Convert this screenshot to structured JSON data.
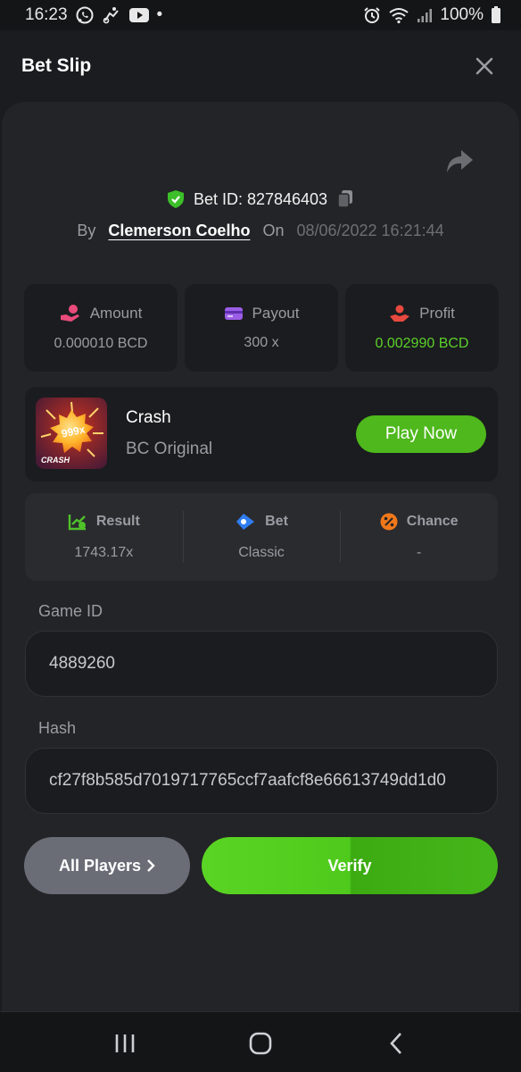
{
  "status_bar": {
    "time": "16:23",
    "battery": "100%",
    "dot": "•"
  },
  "header": {
    "title": "Bet Slip"
  },
  "bet": {
    "id_label": "Bet ID: 827846403",
    "by_label": "By",
    "user": "Clemerson Coelho",
    "on_label": "On",
    "date": "08/06/2022 16:21:44"
  },
  "stats": [
    {
      "label": "Amount",
      "value": "0.000010 BCD",
      "icon": "hand-coin-icon",
      "color": "#e94b7b"
    },
    {
      "label": "Payout",
      "value": "300 x",
      "icon": "wallet-card-icon",
      "color": "#9b5de5"
    },
    {
      "label": "Profit",
      "value": "0.002990 BCD",
      "icon": "hand-profit-icon",
      "color": "#e8493f"
    }
  ],
  "game": {
    "thumb_multiplier": "999x",
    "thumb_label": "CRASH",
    "name": "Crash",
    "subtitle": "BC Original",
    "play_label": "Play Now"
  },
  "details": [
    {
      "label": "Result",
      "value": "1743.17x",
      "icon": "chart-check-icon"
    },
    {
      "label": "Bet",
      "value": "Classic",
      "icon": "ticket-icon"
    },
    {
      "label": "Chance",
      "value": "-",
      "icon": "percent-icon"
    }
  ],
  "fields": {
    "game_id_label": "Game ID",
    "game_id_value": "4889260",
    "hash_label": "Hash",
    "hash_value": "cf27f8b585d7019717765ccf7aafcf8e66613749dd1d0"
  },
  "actions": {
    "players_label": "All Players",
    "verify_label": "Verify"
  },
  "colors": {
    "accent_green": "#4eb81c",
    "profit_green": "#5bd12a",
    "background": "#1b1c1f"
  }
}
